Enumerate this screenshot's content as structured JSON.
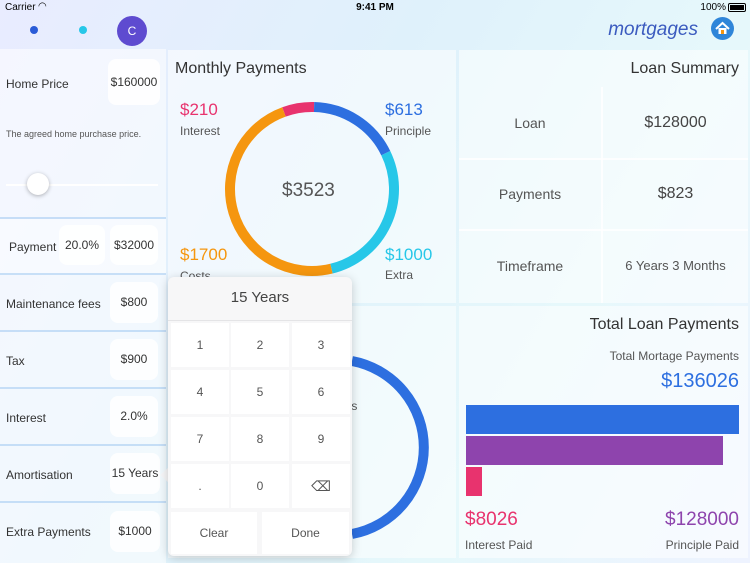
{
  "status_bar": {
    "carrier": "Carrier",
    "time": "9:41 PM",
    "battery": "100%"
  },
  "header": {
    "avatar_initial": "C",
    "brand": "mortgages"
  },
  "left_panel": {
    "home_price": {
      "label": "Home Price",
      "value": "$160000",
      "hint": "The agreed home purchase price.",
      "slider_level": 0.2
    },
    "payment": {
      "label": "Payment",
      "percent": "20.0%",
      "value": "$32000"
    },
    "maintenance": {
      "label": "Maintenance fees",
      "value": "$800"
    },
    "tax": {
      "label": "Tax",
      "value": "$900"
    },
    "interest": {
      "label": "Interest",
      "value": "2.0%"
    },
    "amortisation": {
      "label": "Amortisation",
      "value": "15 Years"
    },
    "extra": {
      "label": "Extra Payments",
      "value": "$1000"
    }
  },
  "monthly_payments": {
    "title": "Monthly Payments",
    "total": "$3523",
    "segments": [
      {
        "amount": "$210",
        "label": "Interest",
        "color": "#e8336e",
        "value": 210
      },
      {
        "amount": "$613",
        "label": "Principle",
        "color": "#2d6fe0",
        "value": 613
      },
      {
        "amount": "$1000",
        "label": "Extra",
        "color": "#27c7e8",
        "value": 1000
      },
      {
        "amount": "$1700",
        "label": "Costs",
        "color": "#f5960f",
        "value": 1700
      }
    ],
    "second_label_fragment": "ts"
  },
  "loan_summary": {
    "title": "Loan Summary",
    "rows": [
      {
        "label": "Loan",
        "value": "$128000"
      },
      {
        "label": "Payments",
        "value": "$823"
      },
      {
        "label": "Timeframe",
        "value": "6 Years 3 Months"
      }
    ]
  },
  "total_loan_payments": {
    "title": "Total Loan Payments",
    "subtitle": "Total Mortage Payments",
    "total": "$136026",
    "interest": {
      "amount": "$8026",
      "label": "Interest Paid",
      "color": "#e8336e"
    },
    "principle": {
      "amount": "$128000",
      "label": "Principle Paid",
      "color": "#8e44ad"
    },
    "bars": [
      {
        "value": 136026,
        "color": "#2d6fe0"
      },
      {
        "value": 128000,
        "color": "#8e44ad"
      },
      {
        "value": 8026,
        "color": "#e8336e"
      }
    ]
  },
  "keypad": {
    "title": "15 Years",
    "keys": [
      "1",
      "2",
      "3",
      "4",
      "5",
      "6",
      "7",
      "8",
      "9",
      ".",
      "0",
      "⌫"
    ],
    "clear": "Clear",
    "done": "Done"
  }
}
